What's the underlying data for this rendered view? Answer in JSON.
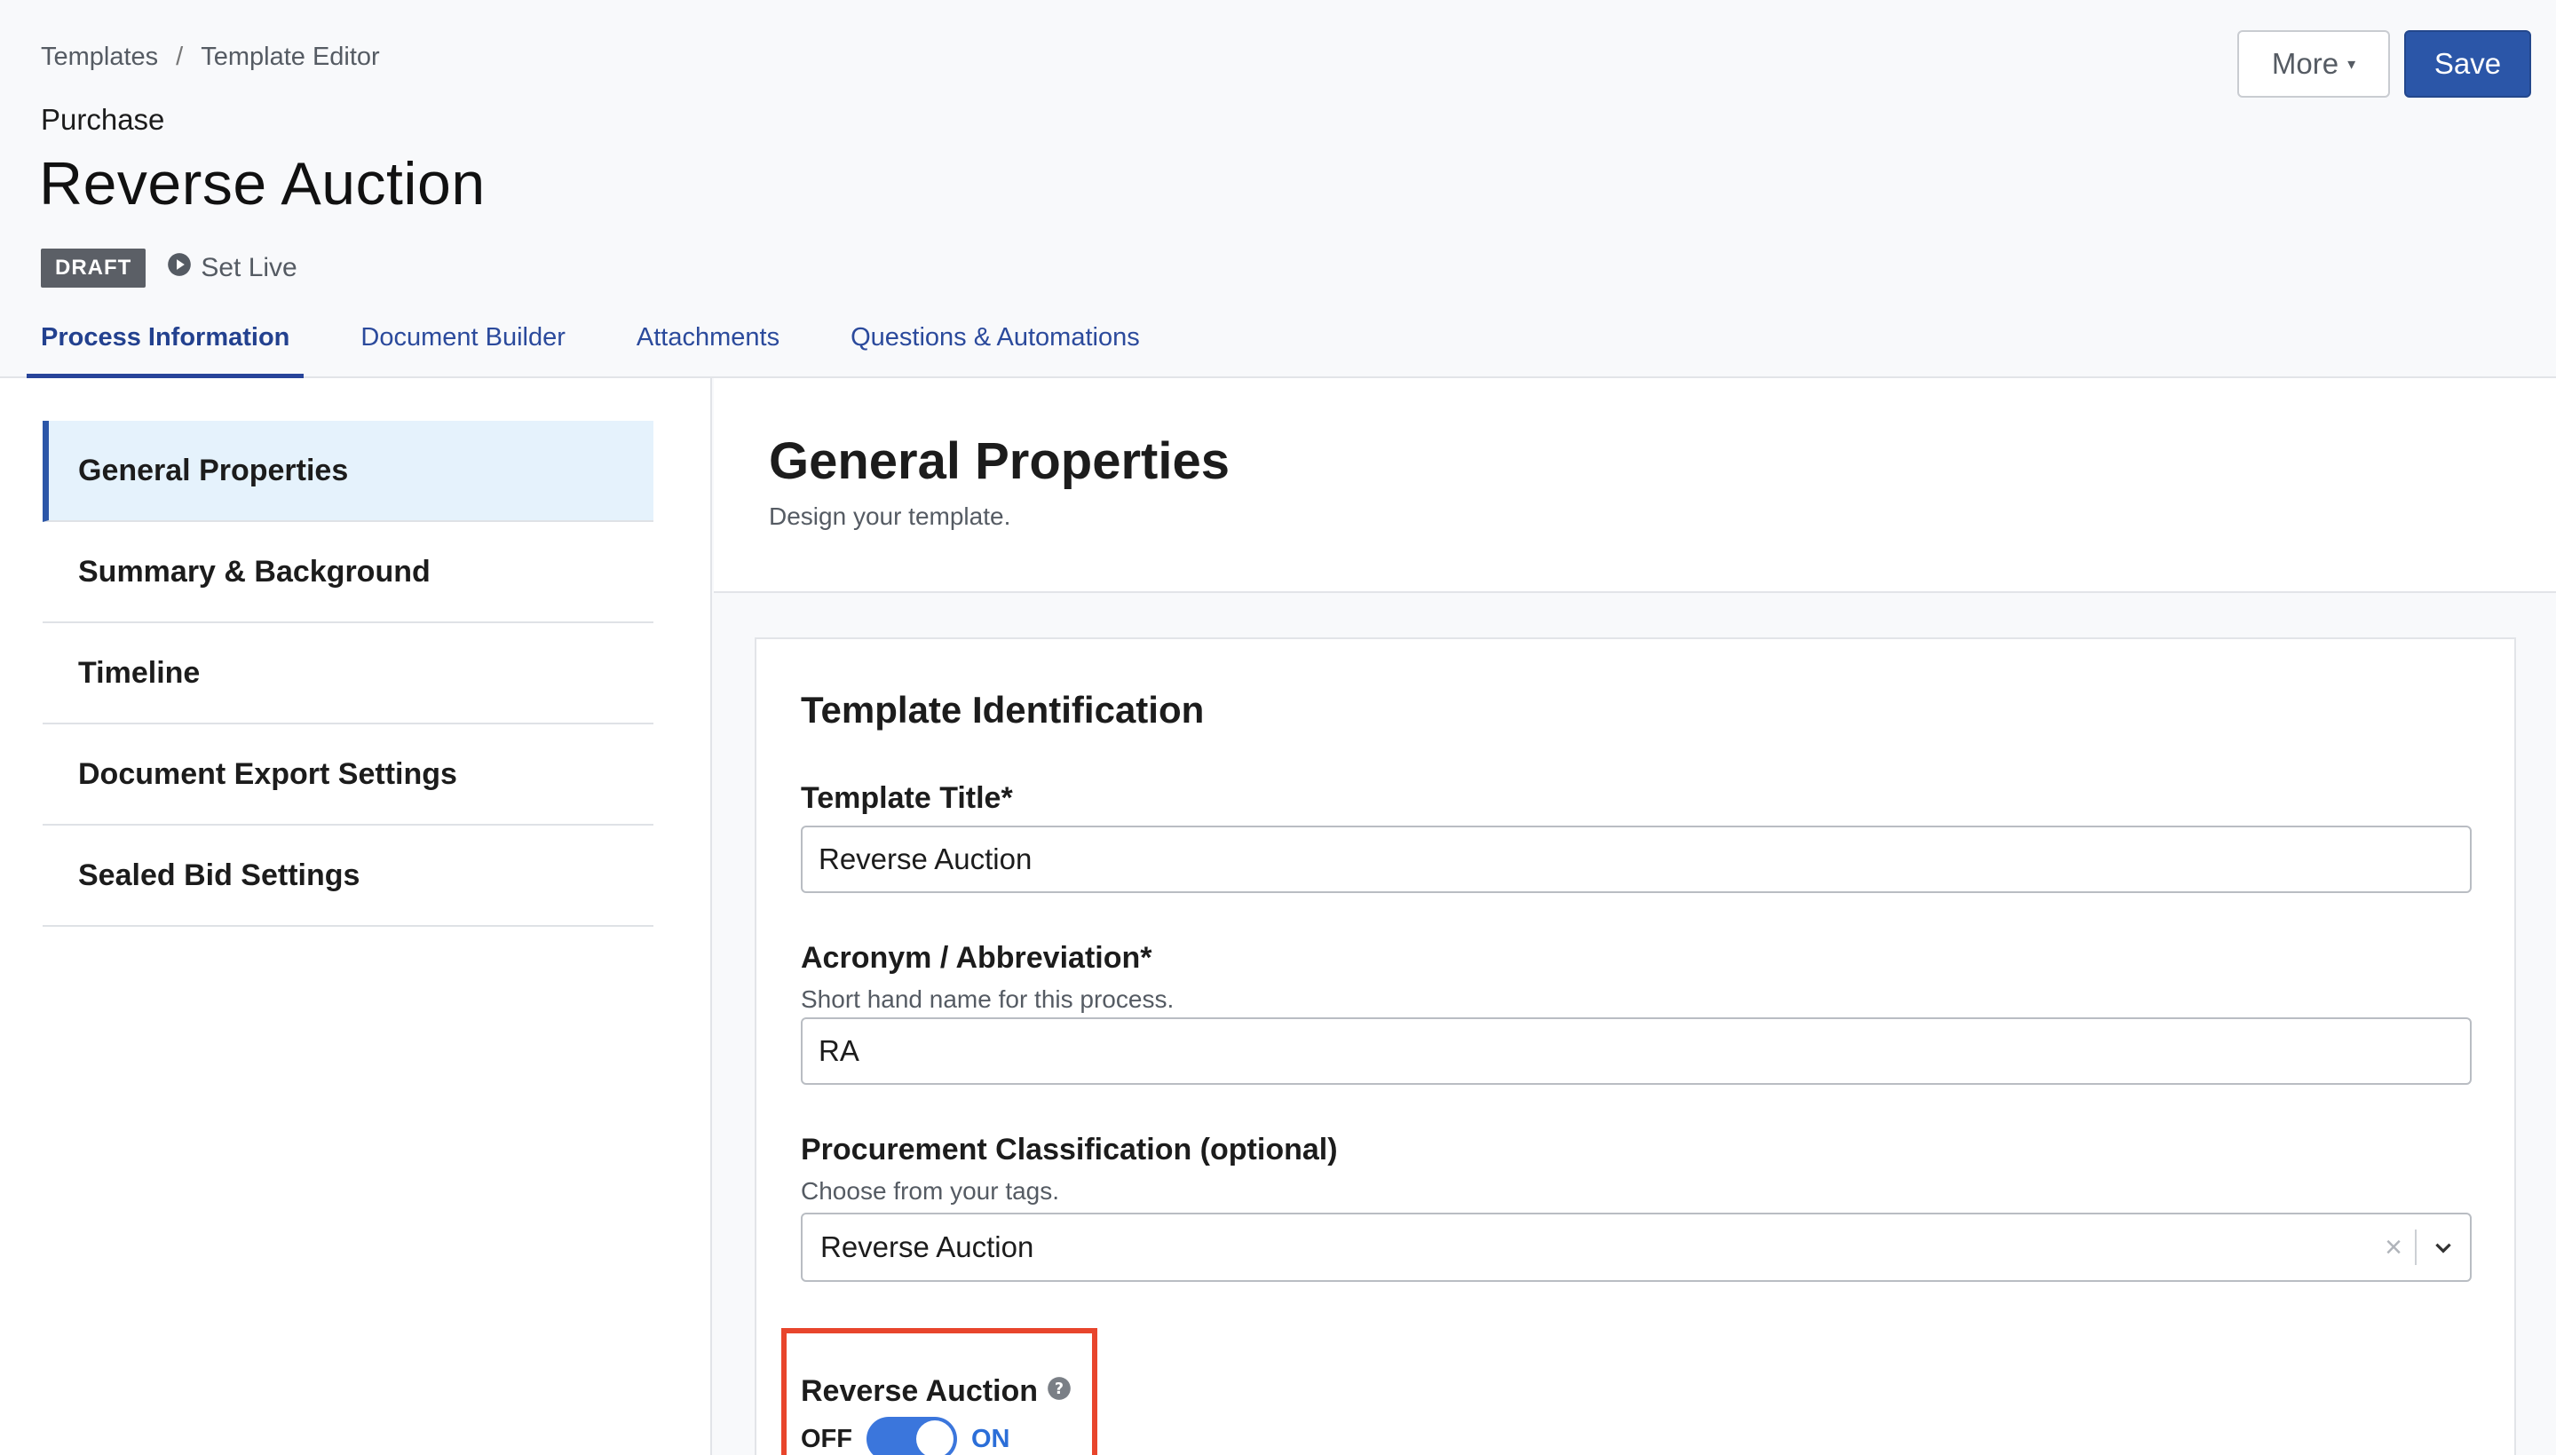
{
  "breadcrumb": [
    "Templates",
    "Template Editor"
  ],
  "breadcrumb_separator": "/",
  "header": {
    "category": "Purchase",
    "title": "Reverse Auction",
    "status_badge": "DRAFT",
    "set_live_label": "Set Live",
    "more_label": "More",
    "save_label": "Save"
  },
  "tabs": [
    {
      "label": "Process Information",
      "active": true
    },
    {
      "label": "Document Builder",
      "active": false
    },
    {
      "label": "Attachments",
      "active": false
    },
    {
      "label": "Questions & Automations",
      "active": false
    }
  ],
  "sidebar": {
    "items": [
      {
        "label": "General Properties",
        "active": true
      },
      {
        "label": "Summary & Background",
        "active": false
      },
      {
        "label": "Timeline",
        "active": false
      },
      {
        "label": "Document Export Settings",
        "active": false
      },
      {
        "label": "Sealed Bid Settings",
        "active": false
      }
    ]
  },
  "main": {
    "title": "General Properties",
    "subtitle": "Design your template.",
    "card": {
      "title": "Template Identification",
      "template_title": {
        "label": "Template Title*",
        "value": "Reverse Auction"
      },
      "acronym": {
        "label": "Acronym / Abbreviation*",
        "help": "Short hand name for this process.",
        "value": "RA"
      },
      "classification": {
        "label": "Procurement Classification (optional)",
        "help": "Choose from your tags.",
        "value": "Reverse Auction"
      },
      "reverse_auction_toggle": {
        "label": "Reverse Auction",
        "off_label": "OFF",
        "on_label": "ON",
        "state": "on"
      }
    }
  },
  "colors": {
    "primary": "#2b56a8",
    "tab_active": "#28449a",
    "sidebar_active_bg": "#e5f2fc",
    "toggle_on": "#3b76dc",
    "highlight": "#e8452c",
    "draft_badge": "#5b5f66"
  },
  "icons": [
    "play-circle-icon",
    "caret-down-icon",
    "clear-icon",
    "chevron-down-icon",
    "help-circle-icon"
  ]
}
